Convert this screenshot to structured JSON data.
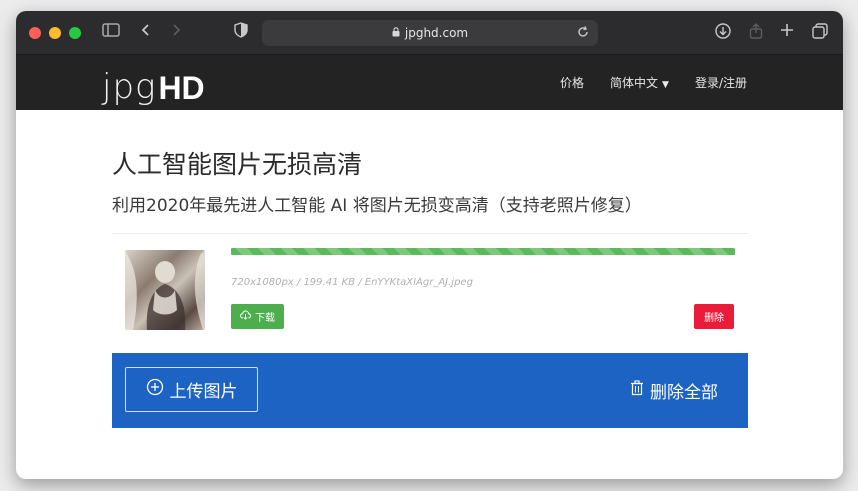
{
  "browser": {
    "url": "jpghd.com"
  },
  "site": {
    "logo_thin": "jpg",
    "logo_bold": "HD",
    "nav": {
      "pricing": "价格",
      "language": "简体中文",
      "login": "登录/注册"
    }
  },
  "hero": {
    "title": "人工智能图片无损高清",
    "subtitle": "利用2020年最先进人工智能 AI 将图片无损变高清（支持老照片修复）"
  },
  "file": {
    "meta": "720x1080px / 199.41 KB / EnYYKtaXIAgr_AJ.jpeg",
    "progress": 1.0,
    "download_label": "下载",
    "delete_label": "删除"
  },
  "actions": {
    "upload_label": "上传图片",
    "delete_all_label": "删除全部"
  },
  "colors": {
    "navbar": "#232323",
    "accent_blue": "#1d63c4",
    "success_green": "#4cae4c",
    "danger_red": "#ea1c3a"
  }
}
